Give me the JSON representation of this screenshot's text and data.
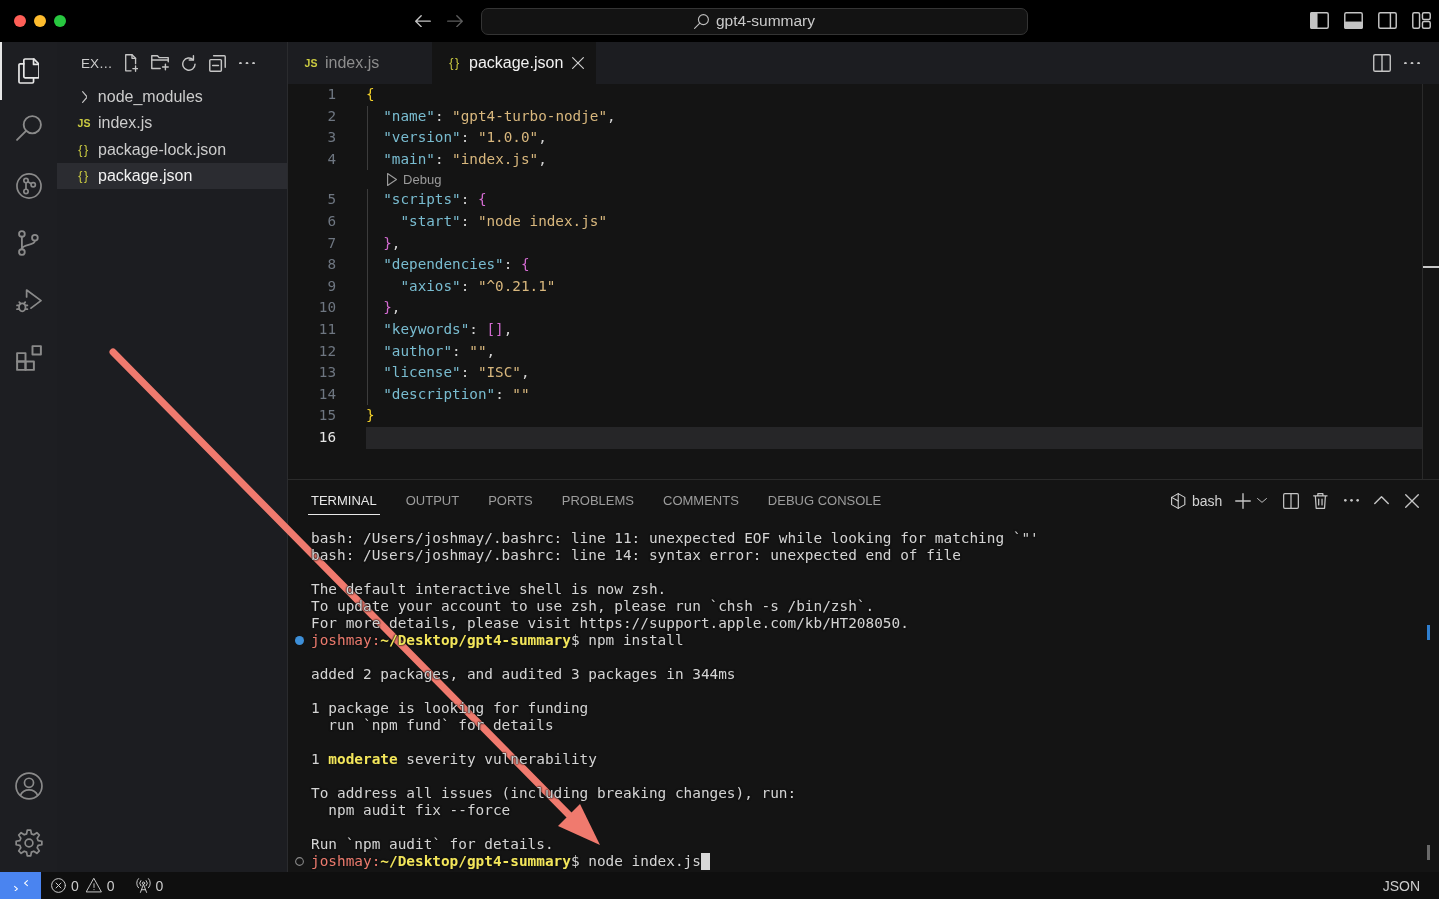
{
  "titlebar": {
    "navigation": [
      {
        "kind": "back",
        "disabled": false
      },
      {
        "kind": "forward",
        "disabled": true
      }
    ],
    "title": "gpt4-summary",
    "layout_toggles": [
      {
        "kind": "primary-sidebar",
        "on": true
      },
      {
        "kind": "panel",
        "on": true
      },
      {
        "kind": "secondary-sidebar",
        "on": false
      }
    ]
  },
  "activity_bar": {
    "items": [
      {
        "kind": "explorer",
        "selected": true
      },
      {
        "kind": "search",
        "selected": false
      },
      {
        "kind": "graph",
        "selected": false
      },
      {
        "kind": "source-control",
        "selected": false
      },
      {
        "kind": "run-debug",
        "selected": false
      },
      {
        "kind": "extensions",
        "selected": false
      }
    ],
    "bottom": [
      {
        "kind": "account"
      },
      {
        "kind": "settings"
      }
    ]
  },
  "explorer": {
    "title": "EX…",
    "items": [
      {
        "kind": "folder",
        "label": "node_modules",
        "expanded": false,
        "selected": false
      },
      {
        "kind": "js",
        "icon": "JS",
        "label": "index.js",
        "selected": false
      },
      {
        "kind": "json",
        "icon": "{}",
        "label": "package-lock.json",
        "selected": false
      },
      {
        "kind": "json",
        "icon": "{}",
        "label": "package.json",
        "selected": true
      }
    ]
  },
  "editor": {
    "tabs": [
      {
        "kind": "js",
        "icon": "JS",
        "label": "index.js",
        "selected": false
      },
      {
        "kind": "json",
        "icon": "{}",
        "label": "package.json",
        "selected": true
      }
    ],
    "lines": [
      {
        "kind": "code",
        "number": "1",
        "current": false,
        "tokens": [
          {
            "kind": "bracket1",
            "text": "{"
          }
        ]
      },
      {
        "kind": "code",
        "number": "2",
        "current": false,
        "tokens": [
          {
            "kind": "key",
            "text": "  \"name\""
          },
          {
            "kind": "punct",
            "text": ": "
          },
          {
            "kind": "string",
            "text": "\"gpt4-turbo-nodje\""
          },
          {
            "kind": "punct",
            "text": ","
          }
        ]
      },
      {
        "kind": "code",
        "number": "3",
        "current": false,
        "tokens": [
          {
            "kind": "key",
            "text": "  \"version\""
          },
          {
            "kind": "punct",
            "text": ": "
          },
          {
            "kind": "string",
            "text": "\"1.0.0\""
          },
          {
            "kind": "punct",
            "text": ","
          }
        ]
      },
      {
        "kind": "code",
        "number": "4",
        "current": false,
        "tokens": [
          {
            "kind": "key",
            "text": "  \"main\""
          },
          {
            "kind": "punct",
            "text": ": "
          },
          {
            "kind": "string",
            "text": "\"index.js\""
          },
          {
            "kind": "punct",
            "text": ","
          }
        ]
      },
      {
        "kind": "codelens",
        "text": "Debug"
      },
      {
        "kind": "code",
        "number": "5",
        "current": false,
        "tokens": [
          {
            "kind": "key",
            "text": "  \"scripts\""
          },
          {
            "kind": "punct",
            "text": ": "
          },
          {
            "kind": "bracket2",
            "text": "{"
          }
        ]
      },
      {
        "kind": "code",
        "number": "6",
        "current": false,
        "tokens": [
          {
            "kind": "key",
            "text": "    \"start\""
          },
          {
            "kind": "punct",
            "text": ": "
          },
          {
            "kind": "string",
            "text": "\"node index.js\""
          }
        ]
      },
      {
        "kind": "code",
        "number": "7",
        "current": false,
        "tokens": [
          {
            "kind": "bracket2",
            "text": "  }"
          },
          {
            "kind": "punct",
            "text": ","
          }
        ]
      },
      {
        "kind": "code",
        "number": "8",
        "current": false,
        "tokens": [
          {
            "kind": "key",
            "text": "  \"dependencies\""
          },
          {
            "kind": "punct",
            "text": ": "
          },
          {
            "kind": "bracket2",
            "text": "{"
          }
        ]
      },
      {
        "kind": "code",
        "number": "9",
        "current": false,
        "tokens": [
          {
            "kind": "key",
            "text": "    \"axios\""
          },
          {
            "kind": "punct",
            "text": ": "
          },
          {
            "kind": "string",
            "text": "\"^0.21.1\""
          }
        ]
      },
      {
        "kind": "code",
        "number": "10",
        "current": false,
        "tokens": [
          {
            "kind": "bracket2",
            "text": "  }"
          },
          {
            "kind": "punct",
            "text": ","
          }
        ]
      },
      {
        "kind": "code",
        "number": "11",
        "current": false,
        "tokens": [
          {
            "kind": "key",
            "text": "  \"keywords\""
          },
          {
            "kind": "punct",
            "text": ": "
          },
          {
            "kind": "bracket2",
            "text": "[]"
          },
          {
            "kind": "punct",
            "text": ","
          }
        ]
      },
      {
        "kind": "code",
        "number": "12",
        "current": false,
        "tokens": [
          {
            "kind": "key",
            "text": "  \"author\""
          },
          {
            "kind": "punct",
            "text": ": "
          },
          {
            "kind": "string",
            "text": "\"\""
          },
          {
            "kind": "punct",
            "text": ","
          }
        ]
      },
      {
        "kind": "code",
        "number": "13",
        "current": false,
        "tokens": [
          {
            "kind": "key",
            "text": "  \"license\""
          },
          {
            "kind": "punct",
            "text": ": "
          },
          {
            "kind": "string",
            "text": "\"ISC\""
          },
          {
            "kind": "punct",
            "text": ","
          }
        ]
      },
      {
        "kind": "code",
        "number": "14",
        "current": false,
        "tokens": [
          {
            "kind": "key",
            "text": "  \"description\""
          },
          {
            "kind": "punct",
            "text": ": "
          },
          {
            "kind": "string",
            "text": "\"\""
          }
        ]
      },
      {
        "kind": "code",
        "number": "15",
        "current": false,
        "tokens": [
          {
            "kind": "bracket1",
            "text": "}"
          }
        ]
      },
      {
        "kind": "code",
        "number": "16",
        "current": true
      }
    ]
  },
  "panel": {
    "tabs": [
      {
        "label": "TERMINAL",
        "selected": true
      },
      {
        "label": "OUTPUT",
        "selected": false
      },
      {
        "label": "PORTS",
        "selected": false
      },
      {
        "label": "PROBLEMS",
        "selected": false
      },
      {
        "label": "COMMENTS",
        "selected": false
      },
      {
        "label": "DEBUG CONSOLE",
        "selected": false
      }
    ],
    "shell": "bash",
    "terminal": {
      "lines": [
        {
          "kind": "output",
          "text": "bash: /Users/joshmay/.bashrc: line 11: unexpected EOF while looking for matching `\"'"
        },
        {
          "kind": "output",
          "text": "bash: /Users/joshmay/.bashrc: line 14: syntax error: unexpected end of file"
        },
        {
          "kind": "blank"
        },
        {
          "kind": "output",
          "text": "The default interactive shell is now zsh."
        },
        {
          "kind": "output",
          "text": "To update your account to use zsh, please run `chsh -s /bin/zsh`."
        },
        {
          "kind": "output",
          "text": "For more details, please visit https://support.apple.com/kb/HT208050."
        },
        {
          "kind": "prompt",
          "finished": true,
          "user": "joshmay:",
          "path": "~/Desktop/gpt4-summary",
          "symbol": "$",
          "command": "npm install",
          "cursor": false
        },
        {
          "kind": "blank"
        },
        {
          "kind": "output",
          "text": "added 2 packages, and audited 3 packages in 344ms"
        },
        {
          "kind": "blank"
        },
        {
          "kind": "output",
          "text": "1 package is looking for funding"
        },
        {
          "kind": "output",
          "text": "  run `npm fund` for details"
        },
        {
          "kind": "blank"
        },
        {
          "kind": "output",
          "text": "1 **moderate** severity vulnerability"
        },
        {
          "kind": "blank"
        },
        {
          "kind": "output",
          "text": "To address all issues (including breaking changes), run:"
        },
        {
          "kind": "output",
          "text": "  npm audit fix --force"
        },
        {
          "kind": "blank"
        },
        {
          "kind": "output",
          "text": "Run `npm audit` for details."
        },
        {
          "kind": "prompt",
          "finished": false,
          "user": "joshmay:",
          "path": "~/Desktop/gpt4-summary",
          "symbol": "$",
          "command": "node index.js",
          "cursor": true
        }
      ]
    }
  },
  "status_bar": {
    "errors": "0",
    "warnings": "0",
    "ports": "0",
    "language": "JSON"
  }
}
